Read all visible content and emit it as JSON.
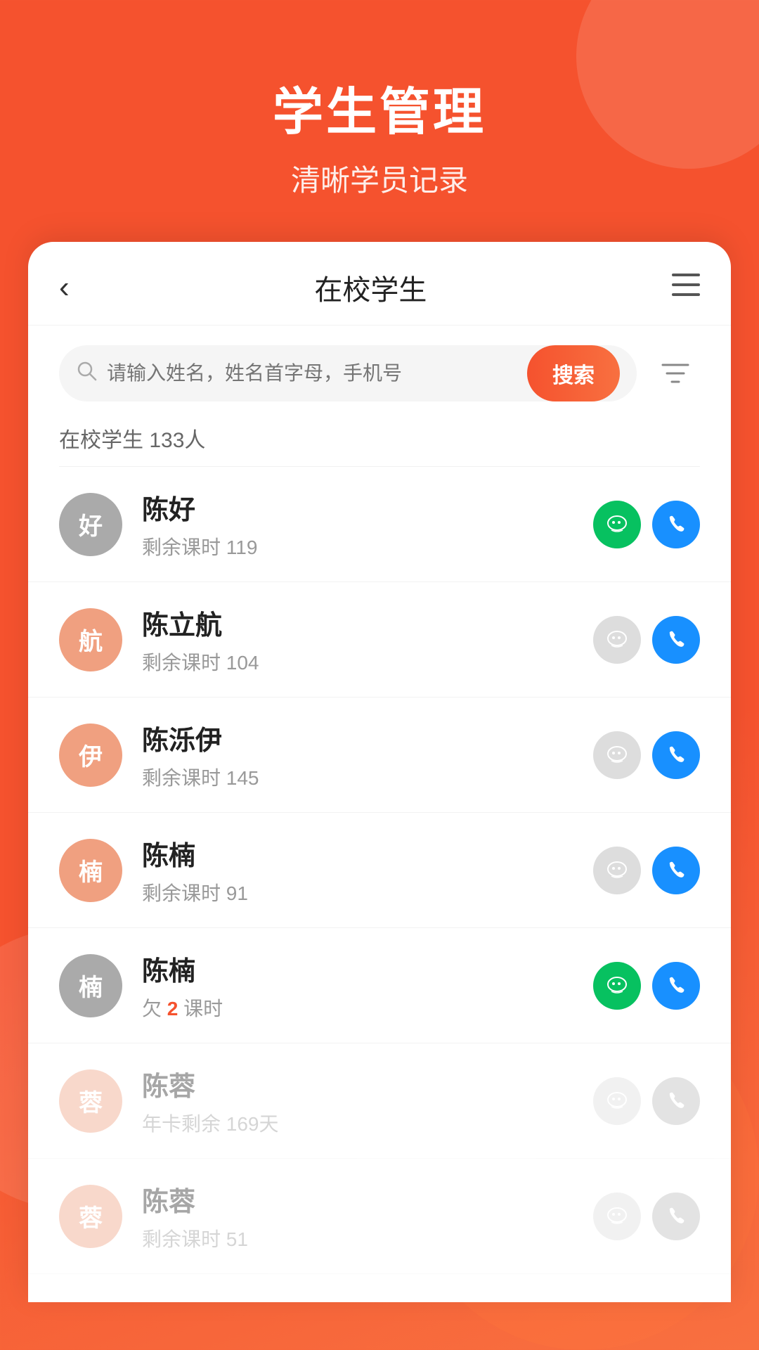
{
  "header": {
    "title": "学生管理",
    "subtitle": "清晰学员记录"
  },
  "nav": {
    "back_label": "‹",
    "page_title": "在校学生",
    "menu_icon": "≡"
  },
  "search": {
    "placeholder": "请输入姓名，姓名首字母，手机号",
    "button_label": "搜索"
  },
  "student_count_label": "在校学生 133人",
  "students": [
    {
      "avatar_char": "好",
      "avatar_class": "avatar-gray",
      "name": "陈好",
      "sub": "剩余课时 119",
      "highlight": null,
      "wechat_active": true,
      "phone_active": true,
      "faded": false
    },
    {
      "avatar_char": "航",
      "avatar_class": "avatar-peach",
      "name": "陈立航",
      "sub": "剩余课时 104",
      "highlight": null,
      "wechat_active": false,
      "phone_active": true,
      "faded": false
    },
    {
      "avatar_char": "伊",
      "avatar_class": "avatar-peach",
      "name": "陈泺伊",
      "sub": "剩余课时 145",
      "highlight": null,
      "wechat_active": false,
      "phone_active": true,
      "faded": false
    },
    {
      "avatar_char": "楠",
      "avatar_class": "avatar-peach",
      "name": "陈楠",
      "sub": "剩余课时 91",
      "highlight": null,
      "wechat_active": false,
      "phone_active": true,
      "faded": false
    },
    {
      "avatar_char": "楠",
      "avatar_class": "avatar-gray",
      "name": "陈楠",
      "sub_pre": "欠 ",
      "sub_highlight": "2",
      "sub_post": " 课时",
      "highlight": true,
      "wechat_active": true,
      "phone_active": true,
      "faded": false
    },
    {
      "avatar_char": "蓉",
      "avatar_class": "avatar-peach",
      "name": "陈蓉",
      "sub": "年卡剩余 169天",
      "highlight": null,
      "wechat_active": false,
      "phone_active": false,
      "faded": true
    },
    {
      "avatar_char": "蓉",
      "avatar_class": "avatar-peach",
      "name": "陈蓉",
      "sub": "剩余课时 51",
      "highlight": null,
      "wechat_active": false,
      "phone_active": false,
      "faded": true
    }
  ]
}
